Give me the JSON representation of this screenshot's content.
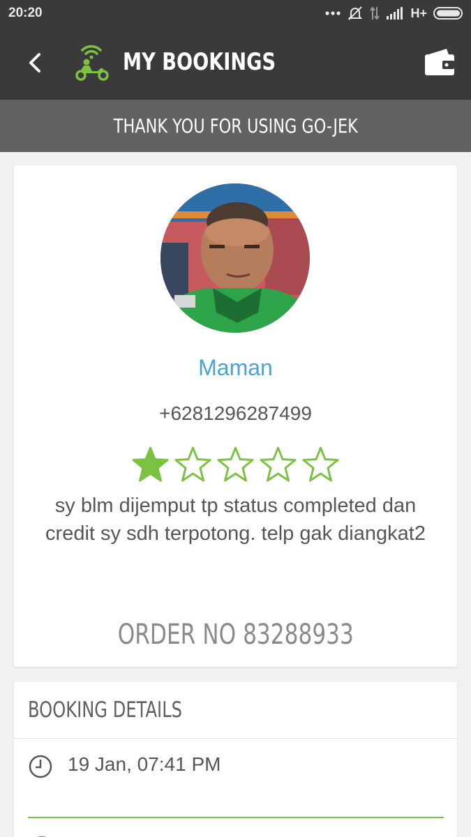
{
  "status_bar": {
    "time": "20:20",
    "network": "H+",
    "icons": [
      "more-dots-icon",
      "alarm-off-icon",
      "data-transfer-icon",
      "signal-icon",
      "battery-icon"
    ]
  },
  "header": {
    "title": "MY BOOKINGS",
    "icons": [
      "back-arrow-icon",
      "gojek-logo-icon",
      "wallet-icon"
    ]
  },
  "banner": {
    "text": "THANK YOU FOR USING GO-JEK"
  },
  "driver": {
    "name": "Maman",
    "phone": "+6281296287499",
    "rating": 1,
    "rating_max": 5,
    "review": "sy blm dijemput tp status completed dan credit sy sdh terpotong. telp gak diangkat2",
    "order_no": "ORDER NO 83288933"
  },
  "booking_details": {
    "title": "BOOKING DETAILS",
    "time": "19 Jan, 07:41 PM"
  },
  "colors": {
    "header_bg": "#3a3a3a",
    "banner_bg": "#626262",
    "accent_green": "#7cc242",
    "name_blue": "#4aa3d6"
  }
}
